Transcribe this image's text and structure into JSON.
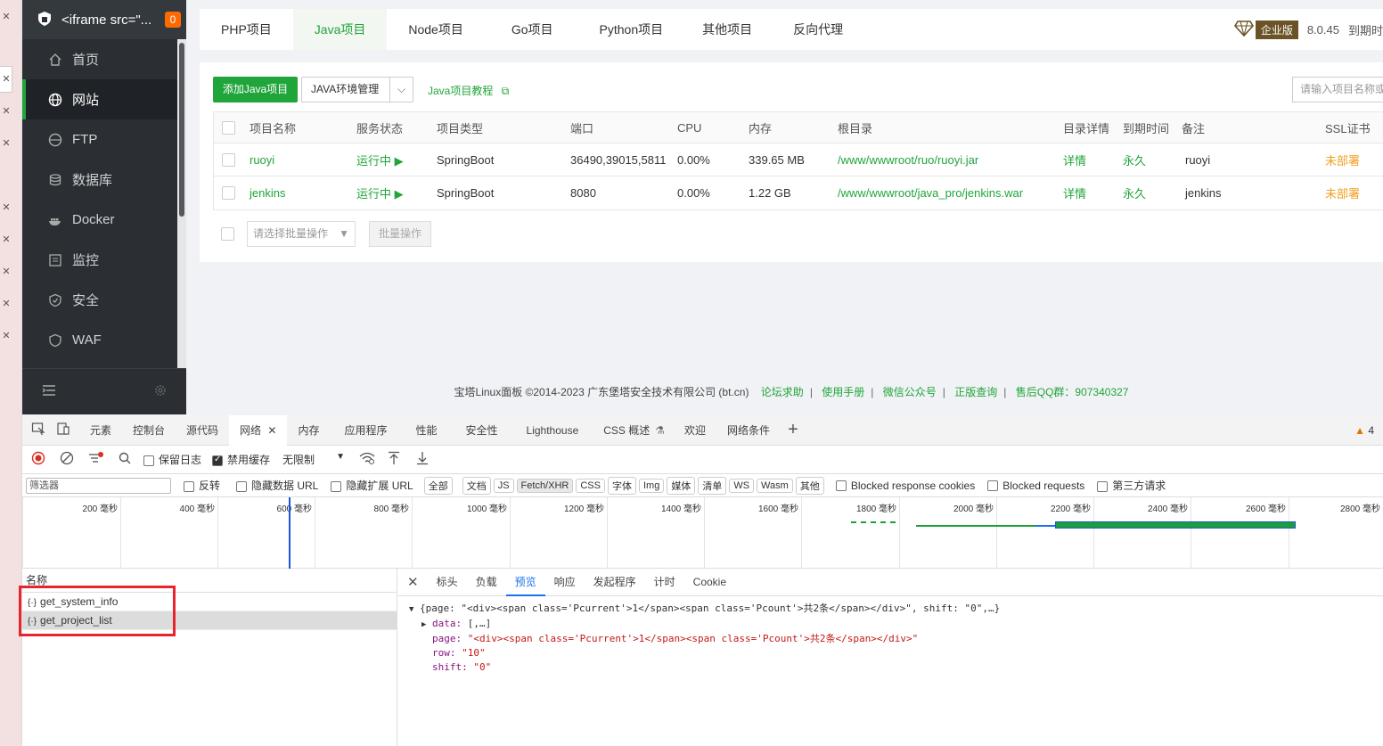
{
  "sidebar": {
    "title": "<iframe src=\"...",
    "badge": "0",
    "items": [
      {
        "label": "首页",
        "icon": "home-icon"
      },
      {
        "label": "网站",
        "icon": "globe-icon"
      },
      {
        "label": "FTP",
        "icon": "ftp-icon"
      },
      {
        "label": "数据库",
        "icon": "database-icon"
      },
      {
        "label": "Docker",
        "icon": "docker-icon"
      },
      {
        "label": "监控",
        "icon": "monitor-icon"
      },
      {
        "label": "安全",
        "icon": "shield-icon"
      },
      {
        "label": "WAF",
        "icon": "waf-icon"
      }
    ]
  },
  "topbar": {
    "tabs": [
      "PHP项目",
      "Java项目",
      "Node项目",
      "Go项目",
      "Python项目",
      "其他项目",
      "反向代理"
    ],
    "edition": "企业版",
    "version": "8.0.45",
    "expire": "到期时"
  },
  "toolbar": {
    "add_button": "添加Java项目",
    "env_select": "JAVA环境管理",
    "tutorial": "Java项目教程",
    "search_placeholder": "请输入项目名称或"
  },
  "table": {
    "headers": [
      "项目名称",
      "服务状态",
      "项目类型",
      "端口",
      "CPU",
      "内存",
      "根目录",
      "目录详情",
      "到期时间",
      "备注",
      "SSL证书"
    ],
    "rows": [
      {
        "name": "ruoyi",
        "status": "运行中 ▶",
        "type": "SpringBoot",
        "port": "36490,39015,5811",
        "cpu": "0.00%",
        "mem": "339.65 MB",
        "root": "/www/wwwroot/ruo/ruoyi.jar",
        "detail": "详情",
        "expire": "永久",
        "note": "ruoyi",
        "ssl": "未部署"
      },
      {
        "name": "jenkins",
        "status": "运行中 ▶",
        "type": "SpringBoot",
        "port": "8080",
        "cpu": "0.00%",
        "mem": "1.22 GB",
        "root": "/www/wwwroot/java_pro/jenkins.war",
        "detail": "详情",
        "expire": "永久",
        "note": "jenkins",
        "ssl": "未部署"
      }
    ],
    "batch_placeholder": "请选择批量操作",
    "batch_button": "批量操作"
  },
  "footer": {
    "copyright": "宝塔Linux面板 ©2014-2023 广东堡塔安全技术有限公司 (bt.cn)",
    "links": [
      "论坛求助",
      "使用手册",
      "微信公众号",
      "正版查询",
      "售后QQ群：907340327"
    ]
  },
  "devtools": {
    "tabs": [
      "元素",
      "控制台",
      "源代码",
      "网络",
      "内存",
      "应用程序",
      "性能",
      "安全性",
      "Lighthouse",
      "CSS 概述",
      "欢迎",
      "网络条件"
    ],
    "warning_count": "4",
    "preserve_log": "保留日志",
    "disable_cache": "禁用缓存",
    "throttle": "无限制",
    "filter_placeholder": "筛选器",
    "invert": "反转",
    "hide_data_url": "隐藏数据 URL",
    "hide_ext_url": "隐藏扩展 URL",
    "chips": [
      "全部",
      "文档",
      "JS",
      "Fetch/XHR",
      "CSS",
      "字体",
      "Img",
      "媒体",
      "清单",
      "WS",
      "Wasm",
      "其他"
    ],
    "blocked_cookies": "Blocked response cookies",
    "blocked_requests": "Blocked requests",
    "third_party": "第三方请求",
    "ticks": [
      "200 毫秒",
      "400 毫秒",
      "600 毫秒",
      "800 毫秒",
      "1000 毫秒",
      "1200 毫秒",
      "1400 毫秒",
      "1600 毫秒",
      "1800 毫秒",
      "2000 毫秒",
      "2200 毫秒",
      "2400 毫秒",
      "2600 毫秒",
      "2800 毫秒"
    ],
    "name_header": "名称",
    "requests": [
      "get_system_info",
      "get_project_list"
    ],
    "detail_tabs": [
      "标头",
      "负载",
      "预览",
      "响应",
      "发起程序",
      "计时",
      "Cookie"
    ],
    "preview": {
      "line1": "{page: \"<div><span class='Pcurrent'>1</span><span class='Pcount'>共2条</span></div>\", shift: \"0\",…}",
      "data_key": "data:",
      "data_val": "[,…]",
      "page_key": "page:",
      "page_val": "\"<div><span class='Pcurrent'>1</span><span class='Pcount'>共2条</span></div>\"",
      "row_key": "row:",
      "row_val": "\"10\"",
      "shift_key": "shift:",
      "shift_val": "\"0\""
    }
  },
  "colors": {
    "accent": "#20a53a",
    "sidebar_bg": "#2b2f33",
    "highlight": "#e8242d"
  }
}
